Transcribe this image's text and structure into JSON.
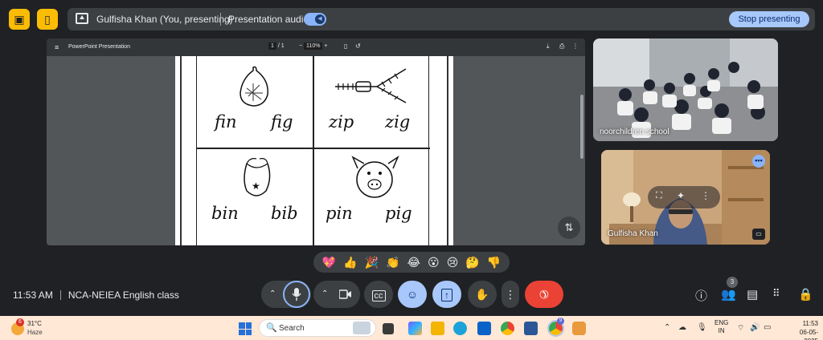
{
  "top_bar": {
    "presenter_name": "Gulfisha Khan (You, presenting)",
    "audio_label": "Presentation audio",
    "stop_label": "Stop presenting"
  },
  "shared_screen": {
    "app_title": "PowerPoint Presentation",
    "page_current": "1",
    "page_total": "/ 1",
    "zoom": "110%",
    "words": [
      "fin",
      "fig",
      "zip",
      "zig",
      "bin",
      "bib",
      "pin",
      "pig"
    ]
  },
  "participants": [
    {
      "name": "noorchildren school"
    },
    {
      "name": "Gulfisha Khan"
    }
  ],
  "reactions": [
    "💖",
    "👍",
    "🎉",
    "👏",
    "😂",
    "😮",
    "😢",
    "🤔",
    "👎"
  ],
  "meeting": {
    "time": "11:53 AM",
    "title": "NCA-NEIEA English class",
    "people_count": "3"
  },
  "taskbar": {
    "weather_badge": "6",
    "temperature": "31°C",
    "condition": "Haze",
    "search_placeholder": "Search",
    "app_badge": "9",
    "lang_1": "ENG",
    "lang_2": "IN",
    "time": "11:53",
    "date": "06-05-2025"
  },
  "colors": {
    "accent": "#a8c7fa",
    "end_call": "#ea4335",
    "icon_yellow": "#fbbc04"
  }
}
